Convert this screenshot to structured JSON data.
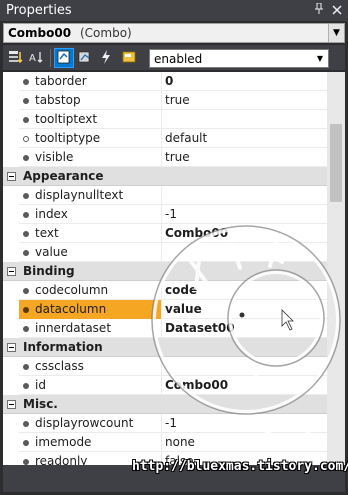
{
  "window": {
    "title": "Properties",
    "pin_glyph": "↑",
    "close_glyph": "×"
  },
  "object_selector": {
    "name": "Combo00",
    "type": "(Combo)"
  },
  "toolbar": {
    "buttons": [
      {
        "name": "categorized-icon",
        "active": false
      },
      {
        "name": "alphabetical-icon",
        "active": false
      },
      {
        "name": "properties-icon",
        "active": true
      },
      {
        "name": "events-icon",
        "active": false
      },
      {
        "name": "lightning-icon",
        "active": false
      },
      {
        "name": "property-pages-icon",
        "active": false
      }
    ],
    "filter_value": "enabled"
  },
  "rows_top": [
    {
      "name": "taborder",
      "value": "0"
    },
    {
      "name": "tabstop",
      "value": "true"
    },
    {
      "name": "tooltiptext",
      "value": ""
    },
    {
      "name": "tooltiptype",
      "value": "default"
    },
    {
      "name": "visible",
      "value": "true"
    }
  ],
  "categories": {
    "appearance": "Appearance",
    "binding": "Binding",
    "information": "Information",
    "misc": "Misc."
  },
  "rows_appearance": [
    {
      "name": "displaynulltext",
      "value": ""
    },
    {
      "name": "index",
      "value": "-1"
    },
    {
      "name": "text",
      "value": "Combo00"
    },
    {
      "name": "value",
      "value": ""
    }
  ],
  "rows_binding": [
    {
      "name": "codecolumn",
      "value": "code"
    },
    {
      "name": "datacolumn",
      "value": "value"
    },
    {
      "name": "innerdataset",
      "value": "Dataset00"
    }
  ],
  "rows_information": [
    {
      "name": "cssclass",
      "value": ""
    },
    {
      "name": "id",
      "value": "Combo00"
    }
  ],
  "rows_misc": [
    {
      "name": "displayrowcount",
      "value": "-1"
    },
    {
      "name": "imemode",
      "value": "none"
    },
    {
      "name": "readonly",
      "value": "false"
    }
  ],
  "watermark": "http://bluexmas.tistory.com/",
  "colors": {
    "selection": "#f5a623",
    "category_bg": "#e0e0e0",
    "active_button": "#007acc"
  }
}
